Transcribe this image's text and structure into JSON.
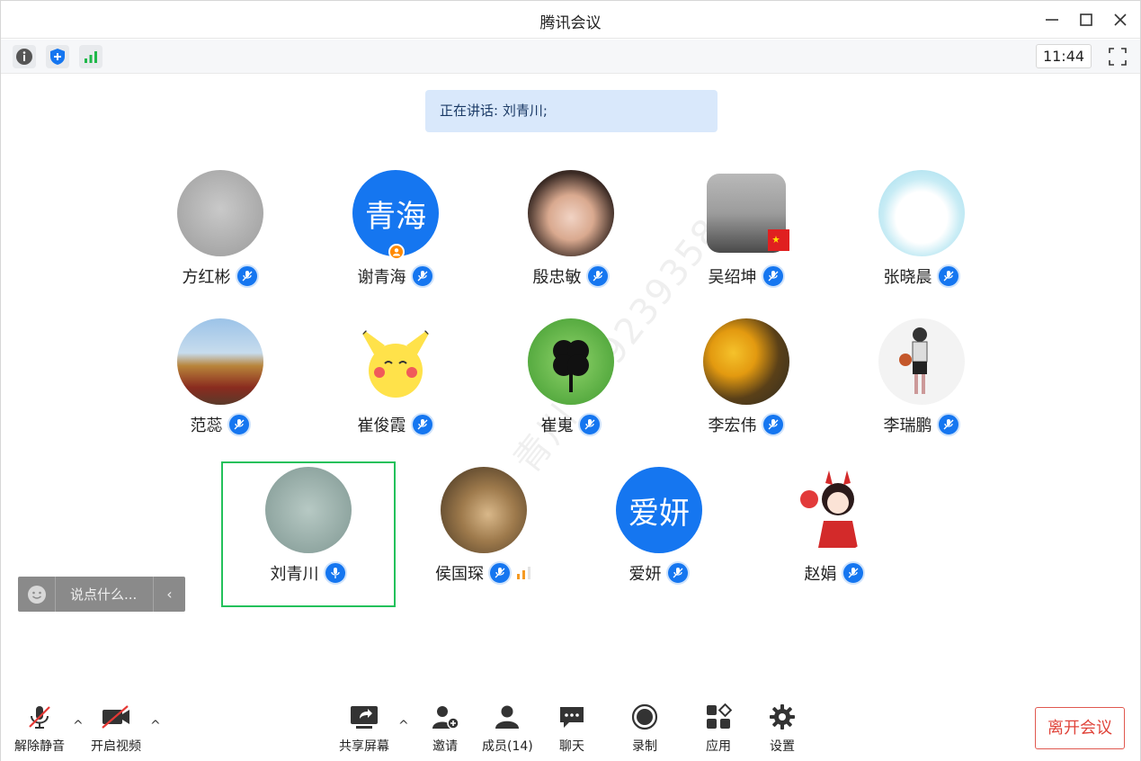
{
  "window": {
    "title": "腾讯会议"
  },
  "infobar": {
    "clock": "11:44"
  },
  "banner": {
    "speaking": "正在讲话: 刘青川;"
  },
  "participants": [
    {
      "name": "方红彬",
      "avatar": "photo",
      "mic": "muted"
    },
    {
      "name": "谢青海",
      "avatar_text": "青海",
      "mic": "muted",
      "host": true
    },
    {
      "name": "殷忠敏",
      "avatar": "photo",
      "mic": "muted"
    },
    {
      "name": "吴绍坤",
      "avatar": "photo",
      "mic": "muted",
      "flag": true
    },
    {
      "name": "张晓晨",
      "avatar": "photo",
      "mic": "muted"
    },
    {
      "name": "范蕊",
      "avatar": "photo",
      "mic": "muted"
    },
    {
      "name": "崔俊霞",
      "avatar": "photo",
      "mic": "muted"
    },
    {
      "name": "崔嵬",
      "avatar": "photo",
      "mic": "muted"
    },
    {
      "name": "李宏伟",
      "avatar": "photo",
      "mic": "muted"
    },
    {
      "name": "李瑞鹏",
      "avatar": "photo",
      "mic": "muted"
    },
    {
      "name": "刘青川",
      "avatar": "photo",
      "mic": "active",
      "speaking": true
    },
    {
      "name": "侯国琛",
      "avatar": "photo",
      "mic": "muted",
      "signal": "weak"
    },
    {
      "name": "爱妍",
      "avatar_text": "爱妍",
      "mic": "muted"
    },
    {
      "name": "赵娟",
      "avatar": "photo",
      "mic": "muted"
    }
  ],
  "chat": {
    "placeholder": "说点什么..."
  },
  "watermark": "青川 13923935802",
  "toolbar": {
    "unmute": "解除静音",
    "video": "开启视频",
    "share": "共享屏幕",
    "invite": "邀请",
    "members": "成员(14)",
    "chat": "聊天",
    "record": "录制",
    "apps": "应用",
    "settings": "设置",
    "leave": "离开会议"
  },
  "colors": {
    "accent": "#1576f0",
    "active_frame": "#23c15b",
    "leave": "#e0443a",
    "banner": "#d9e8fb"
  }
}
